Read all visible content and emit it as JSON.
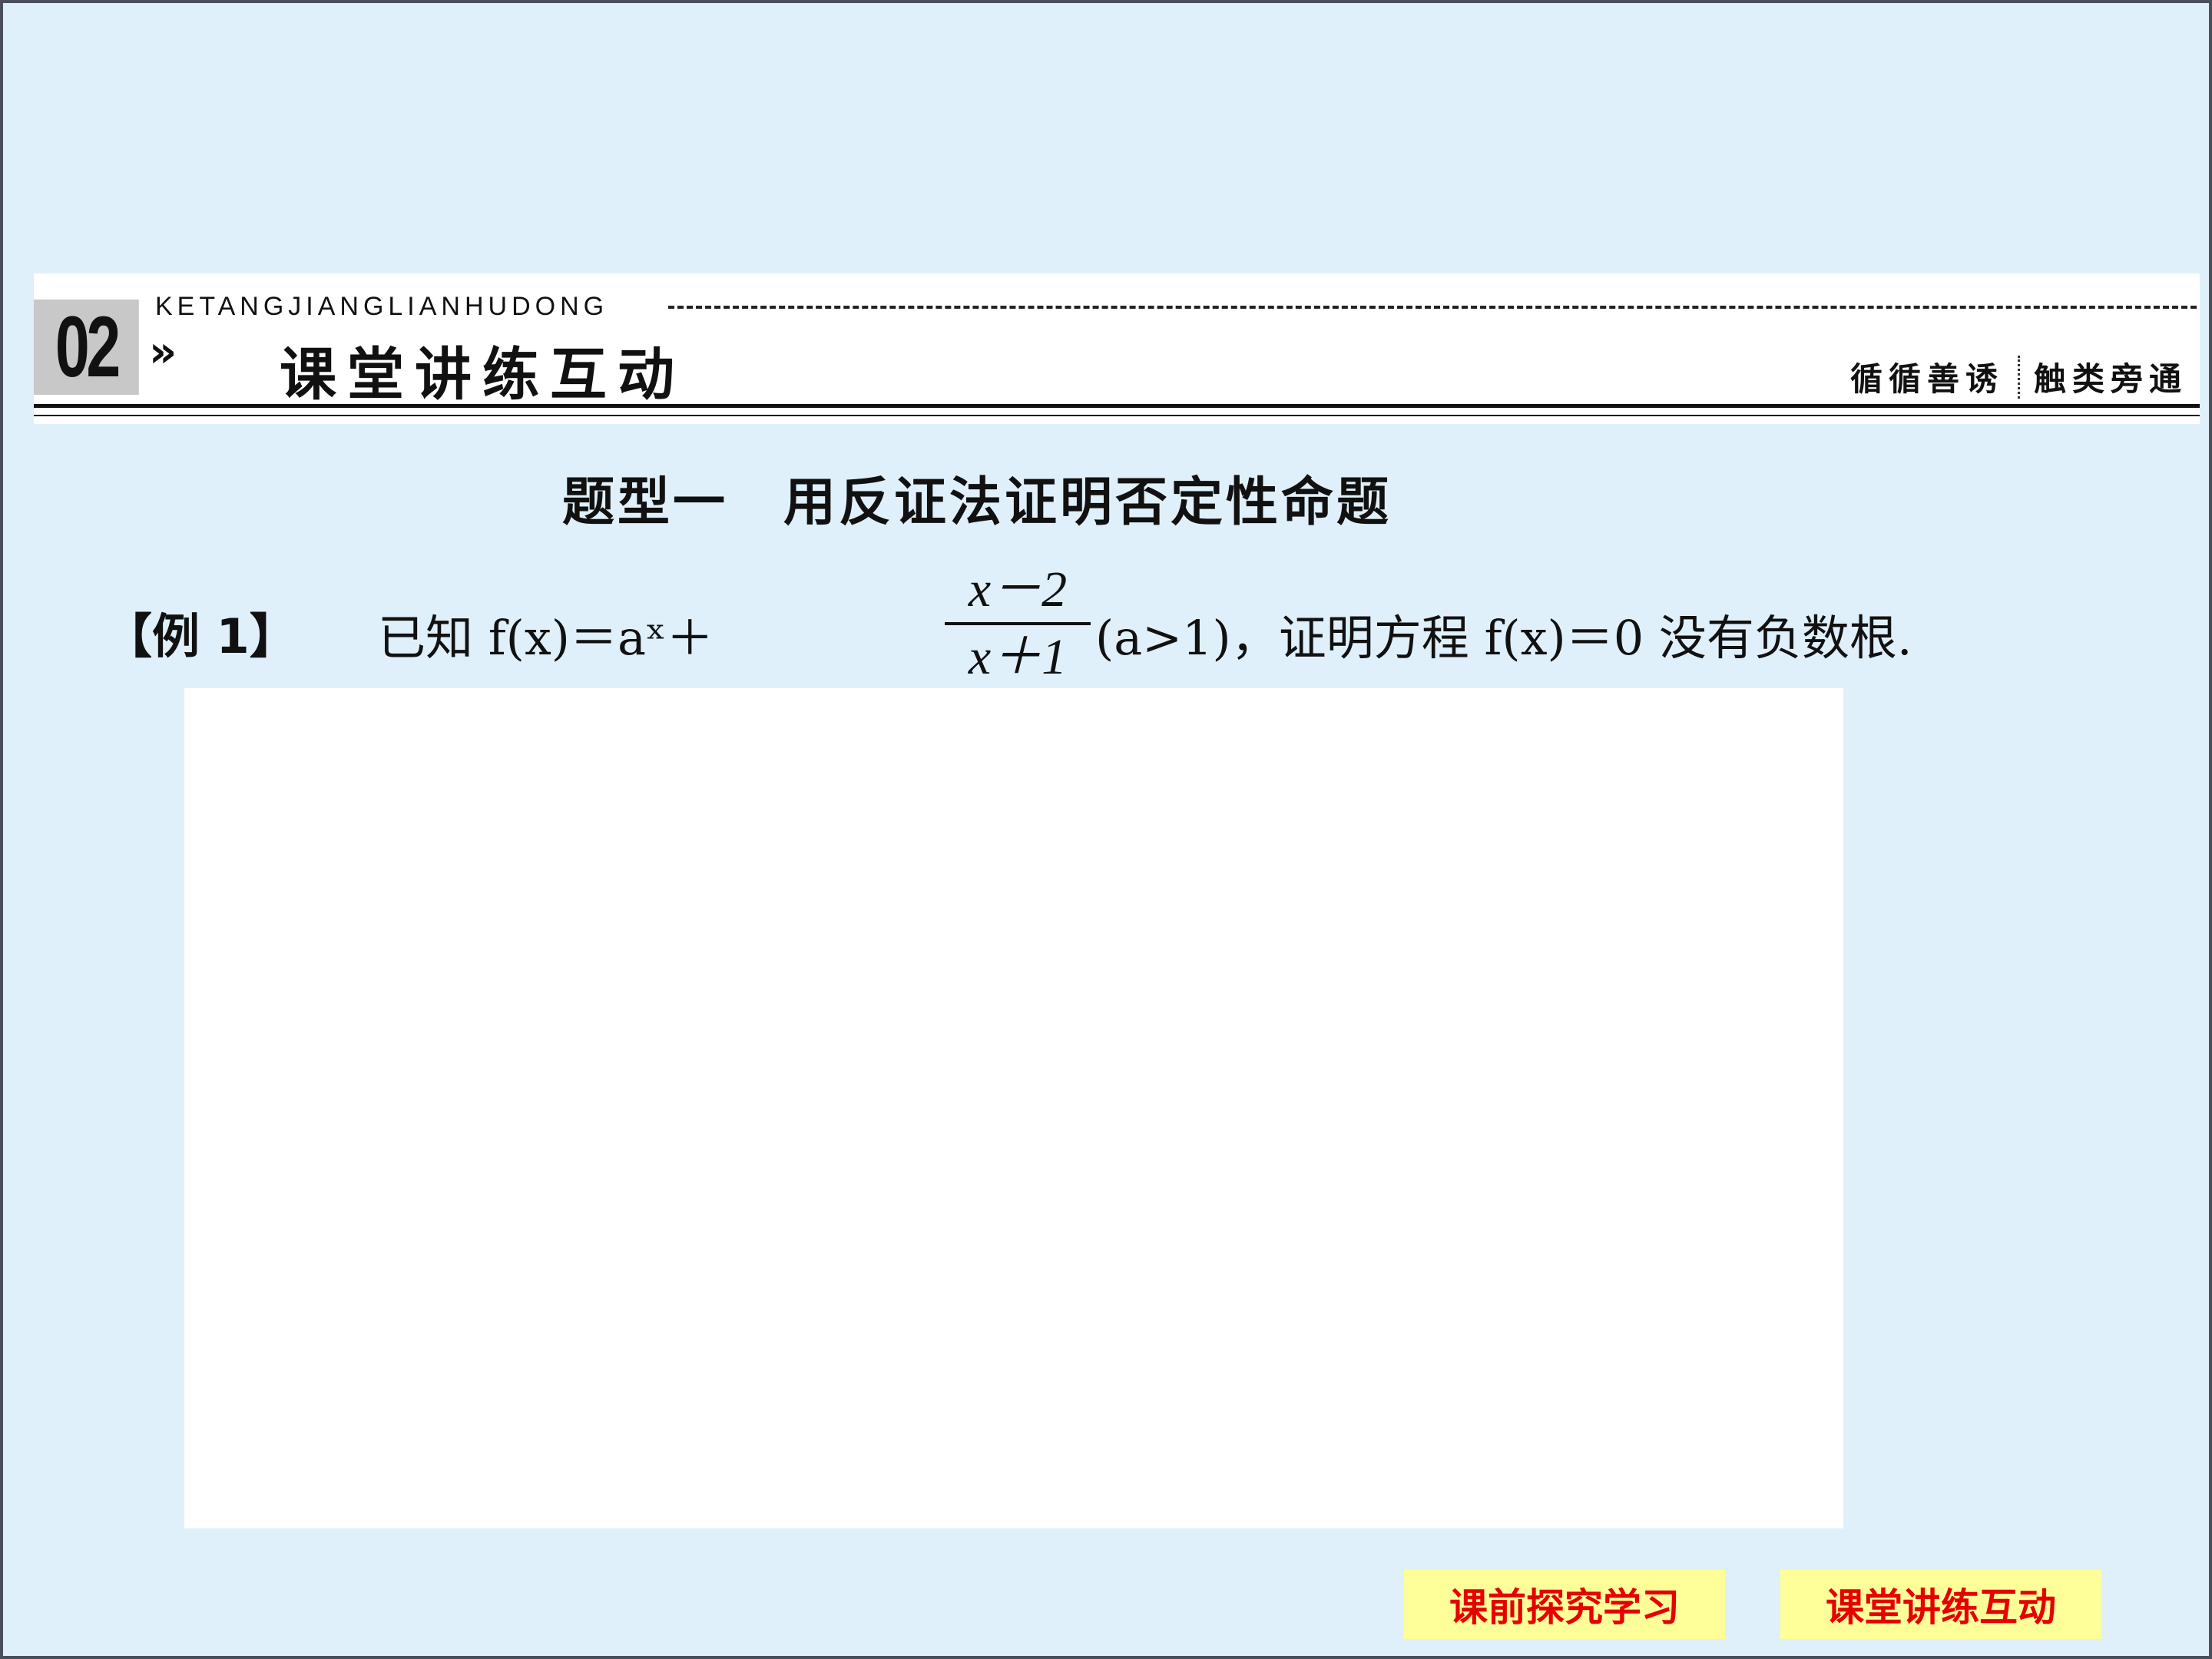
{
  "header": {
    "section_number": "02",
    "chevron": "»",
    "pinyin": "KETANGJIANGLIANHUDONG",
    "title": "课堂讲练互动",
    "motto_left": "循循善诱",
    "motto_right": "触类旁通"
  },
  "topic": {
    "heading": "题型一　用反证法证明否定性命题"
  },
  "example": {
    "label": "【例 1】",
    "text_before": "已知 f(x)＝aˣ＋",
    "fraction_numerator": "x－2",
    "fraction_denominator": "x＋1",
    "text_after": "(a>1)，证明方程 f(x)＝0 没有负数根."
  },
  "nav": {
    "prev_label": "课前探究学习",
    "current_label": "课堂讲练互动"
  },
  "colors": {
    "background": "#dff0fa",
    "nav_button_bg": "#ffff99",
    "nav_button_text": "#e60000"
  }
}
